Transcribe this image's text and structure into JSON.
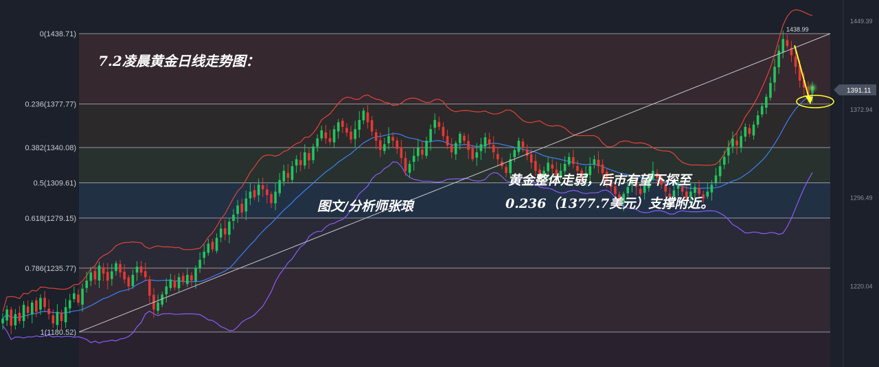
{
  "colors": {
    "background": "#1b202a",
    "bull_candle": "#22c55e",
    "bear_candle": "#e53935",
    "bollinger_upper": "#e0453a",
    "bollinger_middle": "#3b82f6",
    "bollinger_lower": "#8b5cf6",
    "fib_line": "#b9bdc4",
    "trend_line": "#c9ccd2",
    "annotation": "#ffff33"
  },
  "annotations": {
    "title": "7.2凌晨黄金日线走势图：",
    "watermark": "图文/分析师张琅",
    "note_line1": "黄金整体走弱，后市有望下探至",
    "note_line2": "0.236（1377.7美元）支撑附近。",
    "peak_label": "1438.99",
    "current_price_tag": "1391.11"
  },
  "chart_data": {
    "type": "candlestick",
    "title": "7.2凌晨黄金日线走势图：",
    "xlabel": "",
    "ylabel": "",
    "ylim": [
      1150,
      1460
    ],
    "grid": false,
    "fib_levels": [
      {
        "ratio": "0",
        "label": "0(1438.71)",
        "price": 1438.71
      },
      {
        "ratio": "0.236",
        "label": "0.236(1377.77)",
        "price": 1377.77
      },
      {
        "ratio": "0.382",
        "label": "0.382(1340.08)",
        "price": 1340.08
      },
      {
        "ratio": "0.5",
        "label": "0.5(1309.61)",
        "price": 1309.61
      },
      {
        "ratio": "0.618",
        "label": "0.618(1279.15)",
        "price": 1279.15
      },
      {
        "ratio": "0.786",
        "label": "0.786(1235.77)",
        "price": 1235.77
      },
      {
        "ratio": "1",
        "label": "1(1180.52)",
        "price": 1180.52
      }
    ],
    "right_axis_ticks": [
      {
        "label": "1449.39",
        "price": 1449.39
      },
      {
        "label": "1372.94",
        "price": 1372.94
      },
      {
        "label": "1296.49",
        "price": 1296.49
      },
      {
        "label": "1220.04",
        "price": 1220.04
      }
    ],
    "peak": {
      "label": "1438.99",
      "price": 1438.99
    },
    "last_price": 1391.11,
    "trend_line": {
      "from_price": 1180.52,
      "to_price": 1438.71
    },
    "price_path": [
      1192,
      1200,
      1186,
      1196,
      1190,
      1204,
      1197,
      1206,
      1198,
      1210,
      1202,
      1196,
      1188,
      1198,
      1190,
      1202,
      1208,
      1214,
      1206,
      1218,
      1225,
      1232,
      1226,
      1238,
      1231,
      1225,
      1233,
      1240,
      1232,
      1226,
      1220,
      1230,
      1237,
      1232,
      1228,
      1212,
      1200,
      1206,
      1213,
      1220,
      1226,
      1219,
      1228,
      1224,
      1230,
      1225,
      1236,
      1243,
      1250,
      1257,
      1252,
      1262,
      1270,
      1265,
      1276,
      1282,
      1290,
      1284,
      1296,
      1302,
      1297,
      1308,
      1304,
      1299,
      1292,
      1302,
      1312,
      1320,
      1314,
      1324,
      1330,
      1325,
      1336,
      1329,
      1341,
      1348,
      1355,
      1348,
      1345,
      1356,
      1362,
      1358,
      1353,
      1347,
      1356,
      1364,
      1372,
      1362,
      1354,
      1346,
      1338,
      1343,
      1350,
      1346,
      1339,
      1331,
      1320,
      1326,
      1333,
      1340,
      1334,
      1346,
      1356,
      1364,
      1358,
      1350,
      1342,
      1336,
      1344,
      1352,
      1346,
      1338,
      1330,
      1336,
      1343,
      1349,
      1343,
      1336,
      1330,
      1324,
      1318,
      1330,
      1338,
      1346,
      1340,
      1333,
      1327,
      1320,
      1314,
      1320,
      1327,
      1322,
      1316,
      1320,
      1326,
      1332,
      1326,
      1320,
      1314,
      1318,
      1324,
      1330,
      1324,
      1318,
      1312,
      1306,
      1300,
      1294,
      1300,
      1306,
      1312,
      1306,
      1300,
      1307,
      1314,
      1320,
      1314,
      1308,
      1302,
      1297,
      1303,
      1308,
      1302,
      1296,
      1302,
      1306,
      1300,
      1296,
      1302,
      1308,
      1316,
      1324,
      1332,
      1340,
      1348,
      1342,
      1350,
      1358,
      1352,
      1360,
      1368,
      1376,
      1384,
      1396,
      1410,
      1424,
      1434,
      1428,
      1420,
      1410,
      1398,
      1392,
      1386,
      1391
    ]
  }
}
